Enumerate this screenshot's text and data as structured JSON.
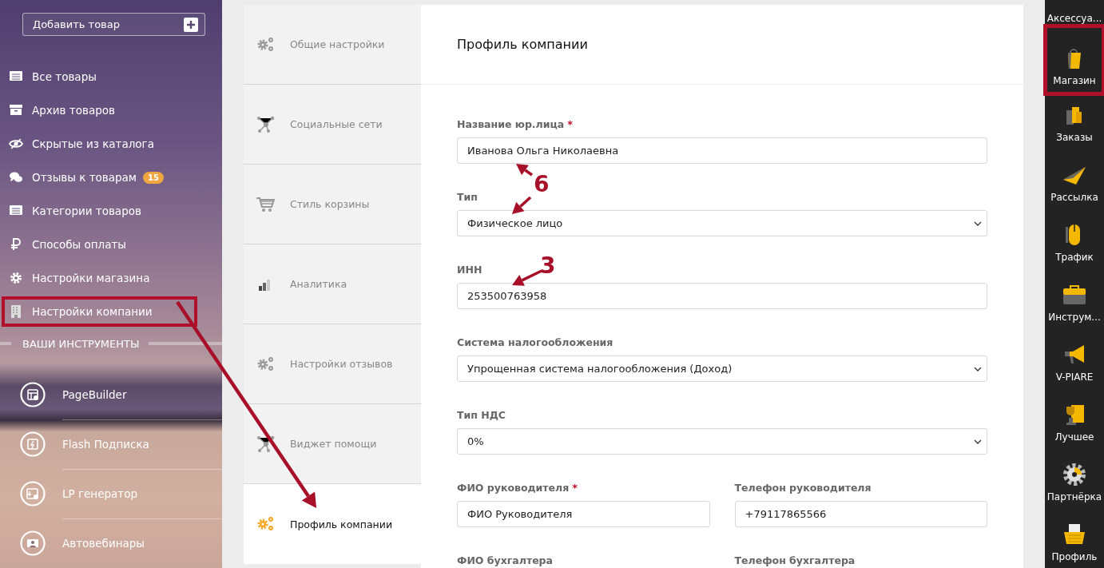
{
  "sidebar": {
    "add_button": "Добавить товар",
    "items": [
      {
        "label": "Все товары",
        "highlighted": false
      },
      {
        "label": "Архив товаров",
        "highlighted": false
      },
      {
        "label": "Скрытые из каталога",
        "highlighted": false
      },
      {
        "label": "Отзывы к товарам",
        "badge": "15",
        "highlighted": false
      },
      {
        "label": "Категории товаров",
        "highlighted": false
      },
      {
        "label": "Способы оплаты",
        "highlighted": false
      },
      {
        "label": "Настройки магазина",
        "highlighted": false
      },
      {
        "label": "Настройки компании",
        "highlighted": true
      }
    ],
    "section_title": "ВАШИ ИНСТРУМЕНТЫ",
    "tools": [
      {
        "label": "PageBuilder"
      },
      {
        "label": "Flash Подписка"
      },
      {
        "label": "LP генератор"
      },
      {
        "label": "Автовебинары"
      }
    ]
  },
  "settings_tabs": [
    {
      "label": "Общие настройки",
      "selected": false
    },
    {
      "label": "Социальные сети",
      "selected": false
    },
    {
      "label": "Стиль корзины",
      "selected": false
    },
    {
      "label": "Аналитика",
      "selected": false
    },
    {
      "label": "Настройки отзывов",
      "selected": false
    },
    {
      "label": "Виджет помощи",
      "selected": false
    },
    {
      "label": "Профиль компании",
      "selected": true
    }
  ],
  "form": {
    "title": "Профиль компании",
    "rows": [
      [
        {
          "label": "Название юр.лица",
          "required_mark": "*",
          "kind": "input",
          "value": "Иванова Ольга Николаевна"
        }
      ],
      [
        {
          "label": "Тип",
          "kind": "select",
          "value": "Физическое лицо"
        }
      ],
      [
        {
          "label": "ИНН",
          "kind": "input",
          "value": "253500763958"
        }
      ],
      [
        {
          "label": "Система налогообложения",
          "kind": "select",
          "value": "Упрощенная система налогообложения (Доход)"
        }
      ],
      [
        {
          "label": "Тип НДС",
          "kind": "select",
          "value": "0%"
        }
      ],
      [
        {
          "label": "ФИО руководителя",
          "required_mark": "*",
          "kind": "input",
          "value": "ФИО Руководителя"
        },
        {
          "label": "Телефон руководителя",
          "kind": "input",
          "value": "+79117865566"
        }
      ],
      [
        {
          "label": "ФИО бухгалтера"
        },
        {
          "label": "Телефон бухгалтера"
        }
      ]
    ]
  },
  "app_bar": {
    "items": [
      {
        "label": "Аксессуа...",
        "highlighted": false
      },
      {
        "label": "Магазин",
        "highlighted": true
      },
      {
        "label": "Заказы",
        "highlighted": false
      },
      {
        "label": "Рассылка",
        "highlighted": false
      },
      {
        "label": "Трафик",
        "highlighted": false
      },
      {
        "label": "Инструм...",
        "highlighted": false
      },
      {
        "label": "V-PIARE",
        "highlighted": false
      },
      {
        "label": "Лучшее",
        "highlighted": false
      },
      {
        "label": "Партнёрка",
        "highlighted": false
      },
      {
        "label": "Профиль",
        "highlighted": false
      }
    ]
  },
  "annotations": {
    "callouts": [
      {
        "text": "6"
      },
      {
        "text": "3"
      }
    ]
  }
}
